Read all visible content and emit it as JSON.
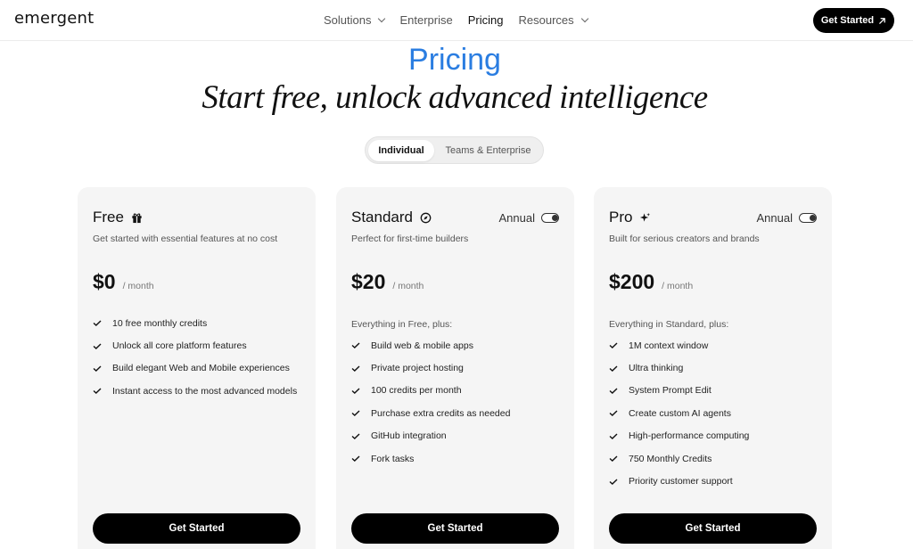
{
  "nav": {
    "logo": "emergent",
    "links": [
      {
        "label": "Solutions",
        "dropdown": true,
        "active": false
      },
      {
        "label": "Enterprise",
        "dropdown": false,
        "active": false
      },
      {
        "label": "Pricing",
        "dropdown": false,
        "active": true
      },
      {
        "label": "Resources",
        "dropdown": true,
        "active": false
      }
    ],
    "cta_label": "Get Started",
    "cta_icon": "arrow-up-right-icon"
  },
  "hero": {
    "eyebrow": "Pricing",
    "headline": "Start free, unlock advanced intelligence"
  },
  "plan_toggle": {
    "options": [
      "Individual",
      "Teams & Enterprise"
    ],
    "selected": "Individual"
  },
  "plans": [
    {
      "name": "Free",
      "icon": "gift-icon",
      "annual_toggle": false,
      "description": "Get started with essential features at no cost",
      "price": "$0",
      "period": "/ month",
      "includes": "",
      "features": [
        "10 free monthly credits",
        "Unlock all core platform features",
        "Build elegant Web and Mobile experiences",
        "Instant access to the most advanced models"
      ],
      "cta": "Get Started"
    },
    {
      "name": "Standard",
      "icon": "compass-icon",
      "annual_toggle": true,
      "annual_label": "Annual",
      "description": "Perfect for first-time builders",
      "price": "$20",
      "period": "/ month",
      "includes": "Everything in Free, plus:",
      "features": [
        "Build web & mobile apps",
        "Private project hosting",
        "100 credits per month",
        "Purchase extra credits as needed",
        "GitHub integration",
        "Fork tasks"
      ],
      "cta": "Get Started"
    },
    {
      "name": "Pro",
      "icon": "sparkle-icon",
      "annual_toggle": true,
      "annual_label": "Annual",
      "description": "Built for serious creators and brands",
      "price": "$200",
      "period": "/ month",
      "includes": "Everything in Standard, plus:",
      "features": [
        "1M context window",
        "Ultra thinking",
        "System Prompt Edit",
        "Create custom AI agents",
        "High-performance computing",
        "750 Monthly Credits",
        "Priority customer support"
      ],
      "cta": "Get Started"
    }
  ],
  "colors": {
    "accent": "#2a7de1",
    "card_bg": "#f5f5f5",
    "cta_bg": "#000000"
  }
}
